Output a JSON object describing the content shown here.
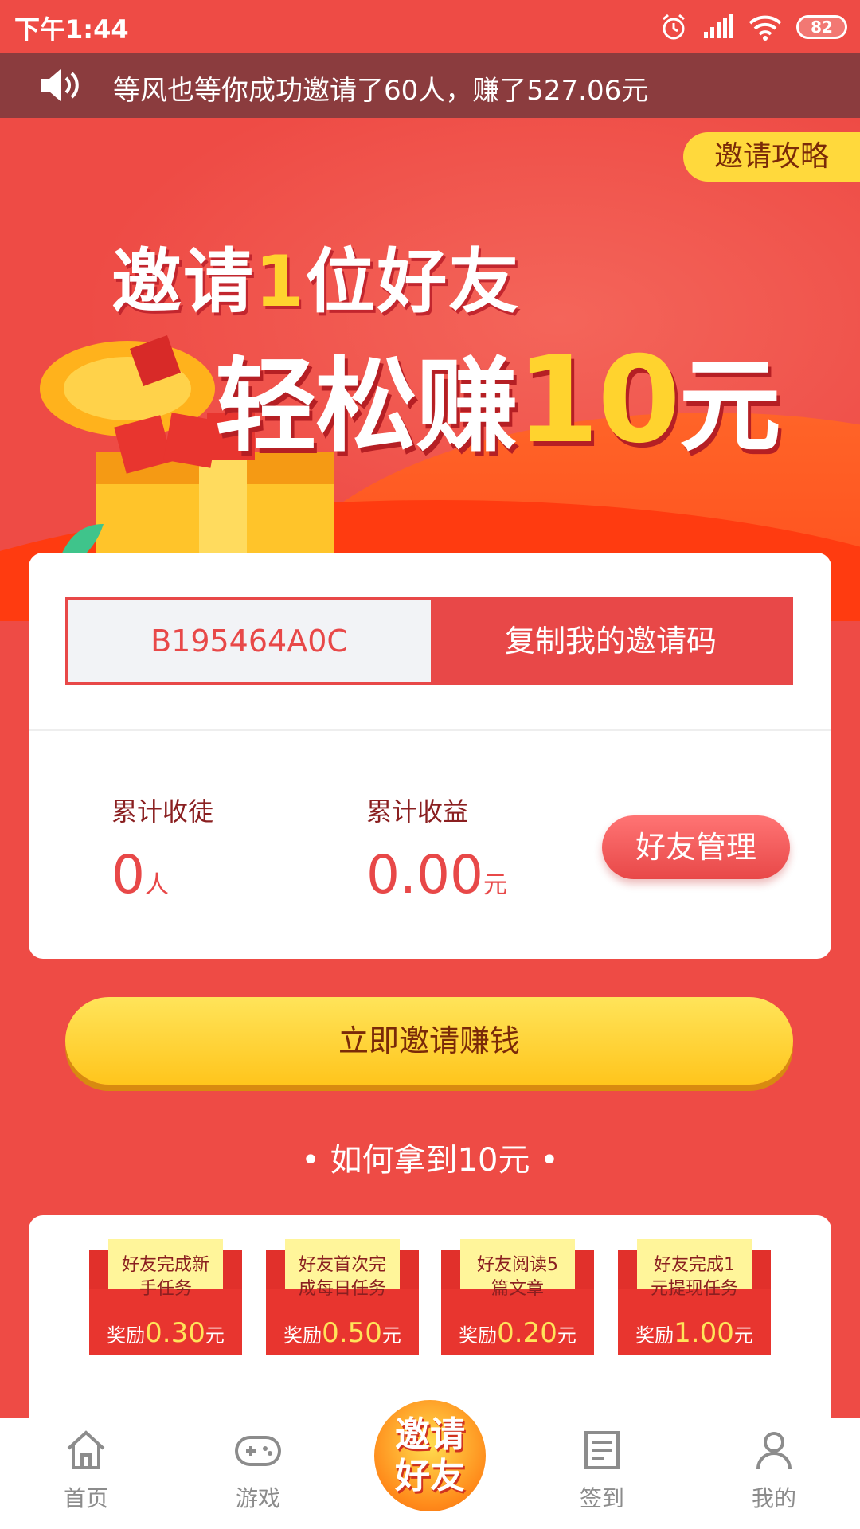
{
  "status_bar": {
    "time": "下午1:44",
    "battery": "82"
  },
  "ticker": {
    "text": "等风也等你成功邀请了60人，赚了527.06元"
  },
  "banner": {
    "strategy_label": "邀请攻略",
    "headline1_pre": "邀请",
    "headline1_num": "1",
    "headline1_post": "位好友",
    "headline2_pre": "轻松赚",
    "headline2_num": "10",
    "headline2_post": "元"
  },
  "invite_card": {
    "code": "B195464A0C",
    "copy_label": "复制我的邀请码",
    "apprentices_label": "累计收徒",
    "apprentices_value": "0",
    "apprentices_unit": "人",
    "earnings_label": "累计收益",
    "earnings_value": "0.00",
    "earnings_unit": "元",
    "friends_button": "好友管理"
  },
  "invite_button": "立即邀请赚钱",
  "how_title": "• 如何拿到10元 •",
  "tasks": [
    {
      "line1": "好友完成新",
      "line2": "手任务",
      "reward_prefix": "奖励",
      "amount": "0.30",
      "unit": "元"
    },
    {
      "line1": "好友首次完",
      "line2": "成每日任务",
      "reward_prefix": "奖励",
      "amount": "0.50",
      "unit": "元"
    },
    {
      "line1": "好友阅读5",
      "line2": "篇文章",
      "reward_prefix": "奖励",
      "amount": "0.20",
      "unit": "元"
    },
    {
      "line1": "好友完成1",
      "line2": "元提现任务",
      "reward_prefix": "奖励",
      "amount": "1.00",
      "unit": "元"
    }
  ],
  "bottom_nav": {
    "home": "首页",
    "games": "游戏",
    "center_line1": "邀请",
    "center_line2": "好友",
    "checkin": "签到",
    "mine": "我的"
  },
  "colors": {
    "primary_red": "#ee4b45",
    "accent_yellow": "#ffd32e",
    "ticker_bg": "#8b3c3e"
  }
}
